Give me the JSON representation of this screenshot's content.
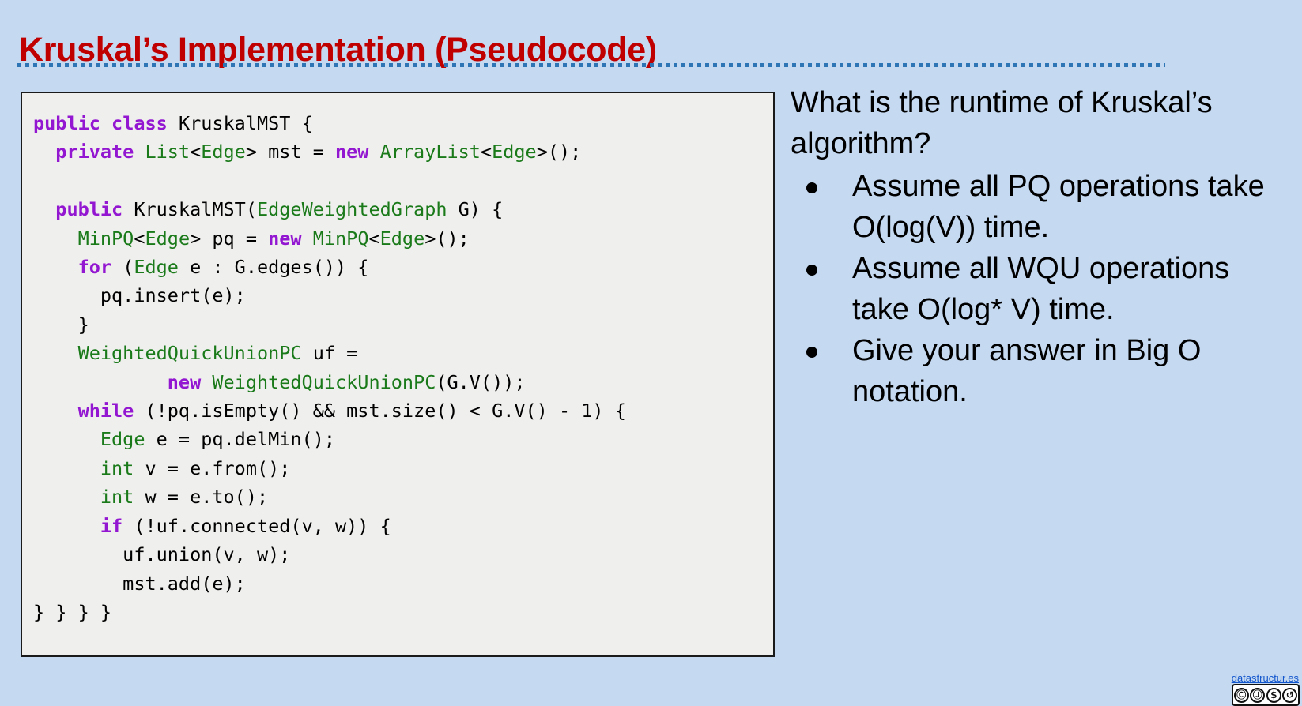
{
  "slide": {
    "title": "Kruskal’s Implementation (Pseudocode)",
    "title_color": "#c00000",
    "background_color": "#c5d9f1",
    "divider_color": "#2e75b6"
  },
  "code_panel": {
    "background_color": "#efefed",
    "border_color": "#1a1a1a",
    "keyword_color": "#9317d1",
    "type_color": "#1a7a1a",
    "text_color": "#000000",
    "lines": [
      [
        [
          "public ",
          "kw"
        ],
        [
          "class ",
          "kw"
        ],
        [
          "KruskalMST {",
          "pl"
        ]
      ],
      [
        [
          "  ",
          "pl"
        ],
        [
          "private ",
          "kw"
        ],
        [
          "List",
          "type"
        ],
        [
          "<",
          "pl"
        ],
        [
          "Edge",
          "type"
        ],
        [
          "> mst = ",
          "pl"
        ],
        [
          "new ",
          "kw"
        ],
        [
          "ArrayList",
          "type"
        ],
        [
          "<",
          "pl"
        ],
        [
          "Edge",
          "type"
        ],
        [
          ">();",
          "pl"
        ]
      ],
      [
        [
          "",
          "pl"
        ]
      ],
      [
        [
          "  ",
          "pl"
        ],
        [
          "public ",
          "kw"
        ],
        [
          "KruskalMST(",
          "pl"
        ],
        [
          "EdgeWeightedGraph",
          "type"
        ],
        [
          " G) {",
          "pl"
        ]
      ],
      [
        [
          "    ",
          "pl"
        ],
        [
          "MinPQ",
          "type"
        ],
        [
          "<",
          "pl"
        ],
        [
          "Edge",
          "type"
        ],
        [
          "> pq = ",
          "pl"
        ],
        [
          "new ",
          "kw"
        ],
        [
          "MinPQ",
          "type"
        ],
        [
          "<",
          "pl"
        ],
        [
          "Edge",
          "type"
        ],
        [
          ">();",
          "pl"
        ]
      ],
      [
        [
          "    ",
          "pl"
        ],
        [
          "for ",
          "kw"
        ],
        [
          "(",
          "pl"
        ],
        [
          "Edge",
          "type"
        ],
        [
          " e : G.edges()) {",
          "pl"
        ]
      ],
      [
        [
          "      pq.insert(e);",
          "pl"
        ]
      ],
      [
        [
          "    }",
          "pl"
        ]
      ],
      [
        [
          "    ",
          "pl"
        ],
        [
          "WeightedQuickUnionPC",
          "type"
        ],
        [
          " uf =",
          "pl"
        ]
      ],
      [
        [
          "            ",
          "pl"
        ],
        [
          "new ",
          "kw"
        ],
        [
          "WeightedQuickUnionPC",
          "type"
        ],
        [
          "(G.V());",
          "pl"
        ]
      ],
      [
        [
          "    ",
          "pl"
        ],
        [
          "while ",
          "kw"
        ],
        [
          "(!pq.isEmpty() && mst.size() < G.V() - 1) {",
          "pl"
        ]
      ],
      [
        [
          "      ",
          "pl"
        ],
        [
          "Edge",
          "type"
        ],
        [
          " e = pq.delMin();",
          "pl"
        ]
      ],
      [
        [
          "      ",
          "pl"
        ],
        [
          "int",
          "type"
        ],
        [
          " v = e.from();",
          "pl"
        ]
      ],
      [
        [
          "      ",
          "pl"
        ],
        [
          "int",
          "type"
        ],
        [
          " w = e.to();",
          "pl"
        ]
      ],
      [
        [
          "      ",
          "pl"
        ],
        [
          "if ",
          "kw"
        ],
        [
          "(!uf.connected(v, w)) {",
          "pl"
        ]
      ],
      [
        [
          "        uf.union(v, w);",
          "pl"
        ]
      ],
      [
        [
          "        mst.add(e);",
          "pl"
        ]
      ],
      [
        [
          "} } } }",
          "pl"
        ]
      ]
    ]
  },
  "question_panel": {
    "heading": "What is the runtime of Kruskal’s algorithm?",
    "bullets": [
      "Assume all PQ operations take O(log(V)) time.",
      "Assume all WQU operations take O(log* V) time.",
      "Give your answer in Big O notation."
    ]
  },
  "footer": {
    "link_text": "datastructur.es",
    "link_color": "#1155cc",
    "license_glyphs": [
      "cc",
      "by",
      "nc",
      "sa"
    ]
  }
}
